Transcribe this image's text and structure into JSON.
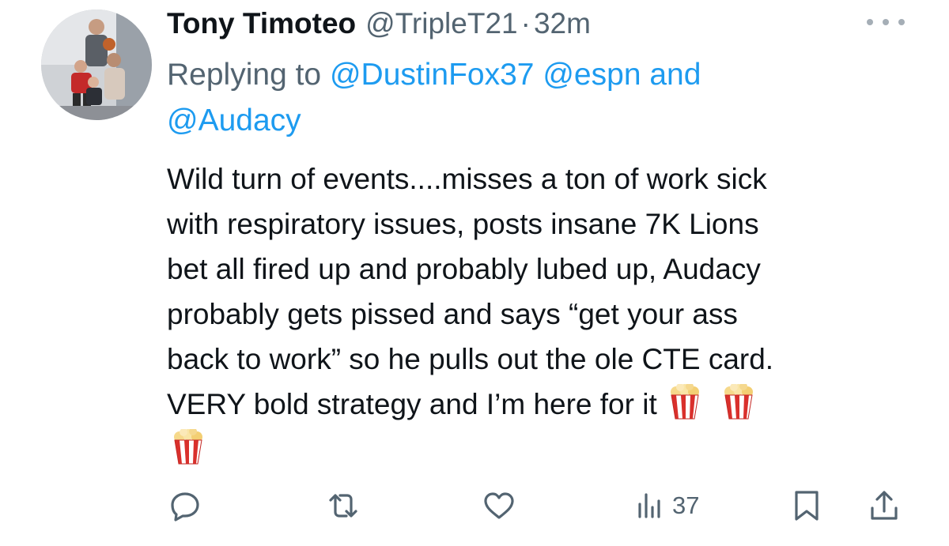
{
  "tweet": {
    "display_name": "Tony Timoteo",
    "handle": "@TripleT21",
    "separator": "·",
    "time": "32m",
    "replying_prefix": "Replying to",
    "replying_mentions": [
      "@DustinFox37",
      "@espn",
      "@Audacy"
    ],
    "replying_conjunction": "and",
    "body_lines": [
      "Wild turn of events....misses a ton of work sick",
      "with respiratory issues, posts insane 7K Lions",
      "bet all fired up and probably lubed up, Audacy",
      "probably gets pissed and says “get your ass",
      "back to work” so he pulls out the ole CTE card.",
      "VERY bold strategy and I’m here for it"
    ],
    "emoji": "popcorn",
    "emoji_count": 3
  },
  "actions": {
    "reply_icon": "reply-icon",
    "retweet_icon": "retweet-icon",
    "like_icon": "heart-icon",
    "views_icon": "views-icon",
    "views_count": "37",
    "bookmark_icon": "bookmark-icon",
    "share_icon": "share-icon"
  },
  "colors": {
    "text": "#0f1419",
    "muted": "#536471",
    "link": "#1d9bf0"
  }
}
